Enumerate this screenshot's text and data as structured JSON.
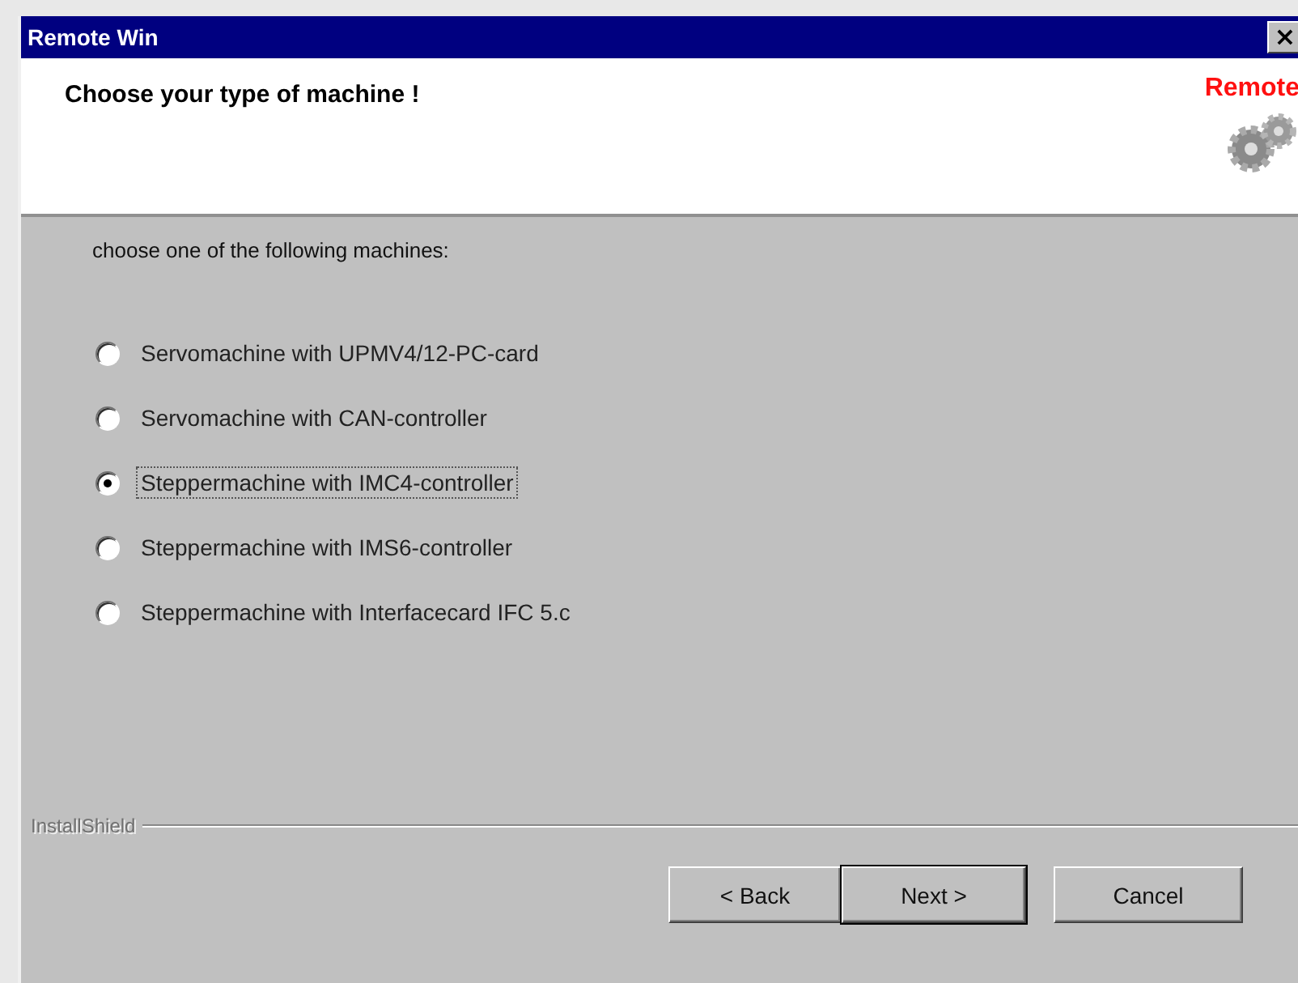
{
  "window": {
    "title": "Remote Win",
    "close": "×"
  },
  "header": {
    "heading": "Choose your type of machine !",
    "logo_text": "Remote"
  },
  "prompt": "choose one of the following machines:",
  "options": [
    {
      "label": "Servomachine with UPMV4/12-PC-card",
      "selected": false
    },
    {
      "label": "Servomachine with CAN-controller",
      "selected": false
    },
    {
      "label": "Steppermachine with IMC4-controller",
      "selected": true
    },
    {
      "label": "Steppermachine with IMS6-controller",
      "selected": false
    },
    {
      "label": "Steppermachine with Interfacecard IFC 5.c",
      "selected": false
    }
  ],
  "brand": "InstallShield",
  "buttons": [
    {
      "label": "< Back",
      "default": false
    },
    {
      "label": "Next >",
      "default": true
    },
    {
      "label": "Cancel",
      "default": false
    }
  ]
}
